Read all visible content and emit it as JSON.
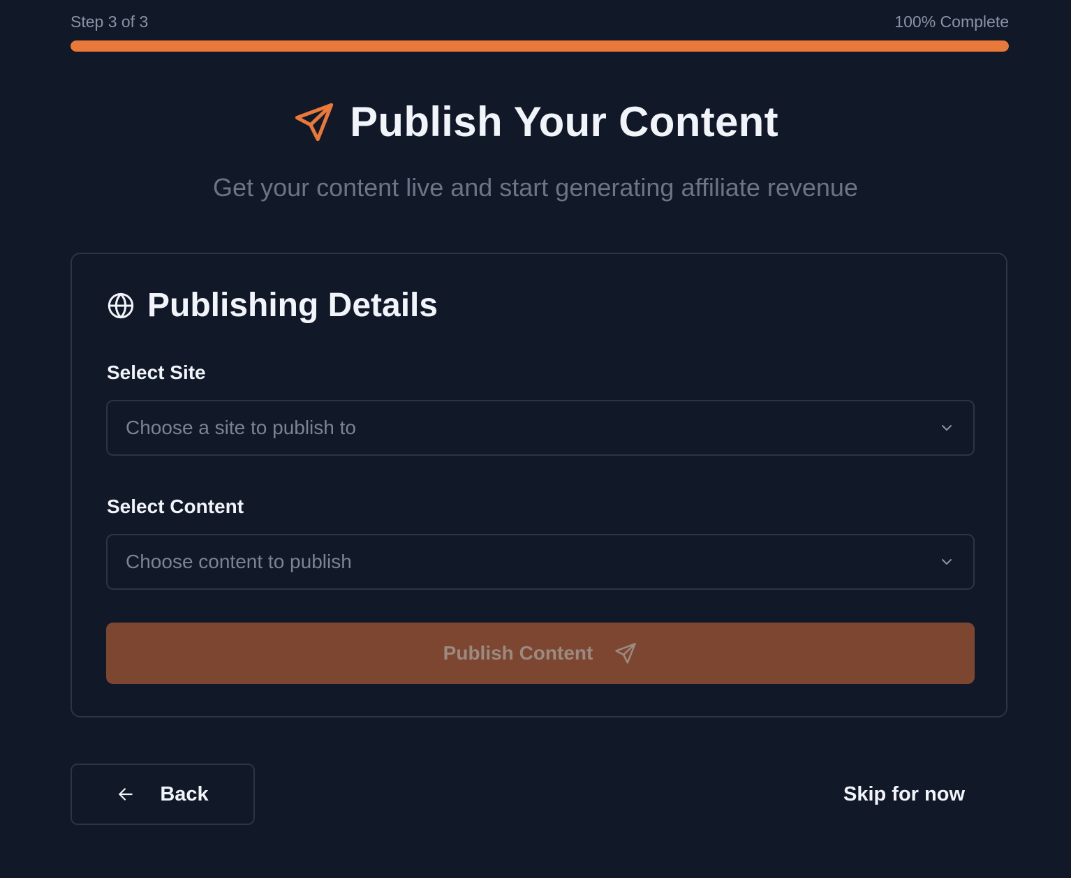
{
  "progress": {
    "step_text": "Step 3 of 3",
    "complete_text": "100% Complete",
    "percent": 100,
    "color": "#e8793a"
  },
  "header": {
    "title": "Publish Your Content",
    "icon": "send-icon",
    "subtitle": "Get your content live and start generating affiliate revenue"
  },
  "card": {
    "title": "Publishing Details",
    "icon": "globe-icon",
    "site_field": {
      "label": "Select Site",
      "placeholder": "Choose a site to publish to"
    },
    "content_field": {
      "label": "Select Content",
      "placeholder": "Choose content to publish"
    },
    "publish_button": {
      "label": "Publish Content",
      "icon": "send-icon"
    }
  },
  "footer": {
    "back_label": "Back",
    "skip_label": "Skip for now"
  },
  "colors": {
    "background": "#111827",
    "accent": "#e8793a",
    "button_disabled": "#7c4630"
  }
}
